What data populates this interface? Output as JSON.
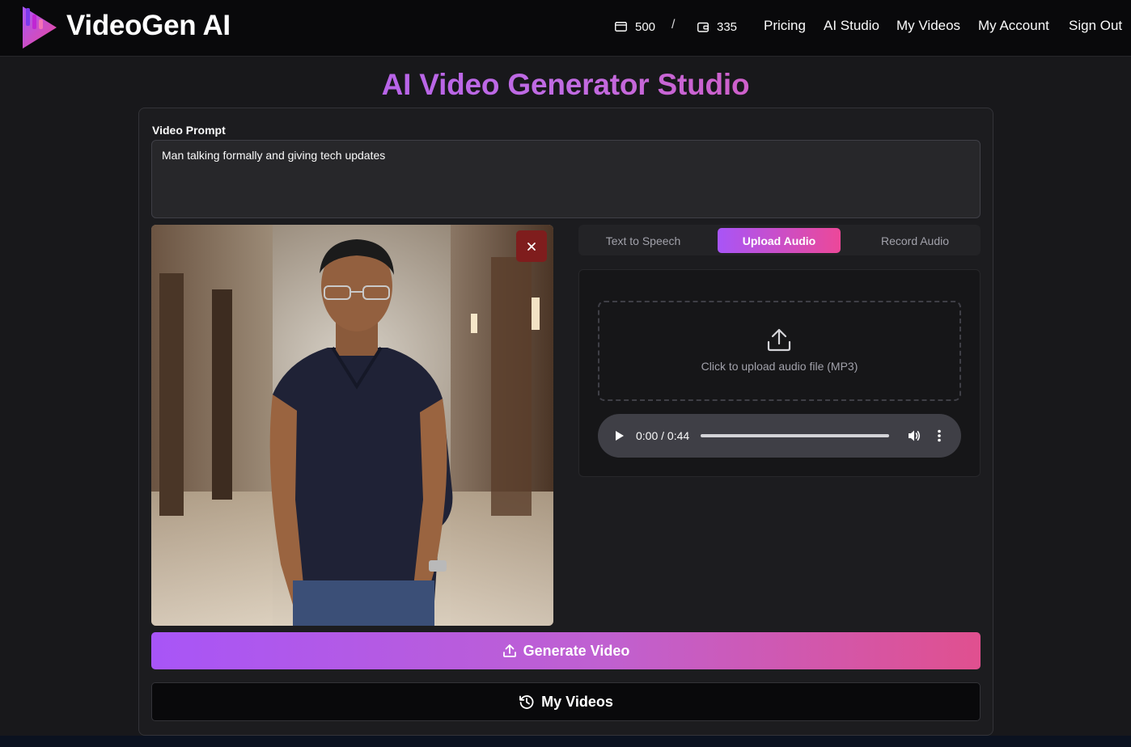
{
  "header": {
    "brand": "VideoGen AI",
    "credits_a": "500",
    "separator": "/",
    "credits_b": "335",
    "nav": {
      "pricing": "Pricing",
      "ai_studio": "AI Studio",
      "my_videos": "My Videos",
      "my_account": "My Account",
      "sign_out": "Sign Out"
    }
  },
  "main": {
    "title": "AI Video Generator Studio",
    "prompt_label": "Video Prompt",
    "prompt_value": "Man talking formally and giving tech updates",
    "tabs": [
      "Text to Speech",
      "Upload Audio",
      "Record Audio"
    ],
    "active_tab": "Upload Audio",
    "upload_text": "Click to upload audio file (MP3)",
    "player": {
      "time": "0:00 / 0:44",
      "progress": 0
    },
    "generate_label": "Generate Video",
    "my_videos_label": "My Videos"
  },
  "colors": {
    "accent_purple": "#a855f7",
    "accent_pink": "#ec4899",
    "remove_red": "#7f1d1d"
  },
  "icons": [
    "logo-icon",
    "card-icon",
    "wallet-icon",
    "close-icon",
    "upload-icon",
    "play-icon",
    "volume-icon",
    "more-vertical-icon",
    "history-icon"
  ]
}
